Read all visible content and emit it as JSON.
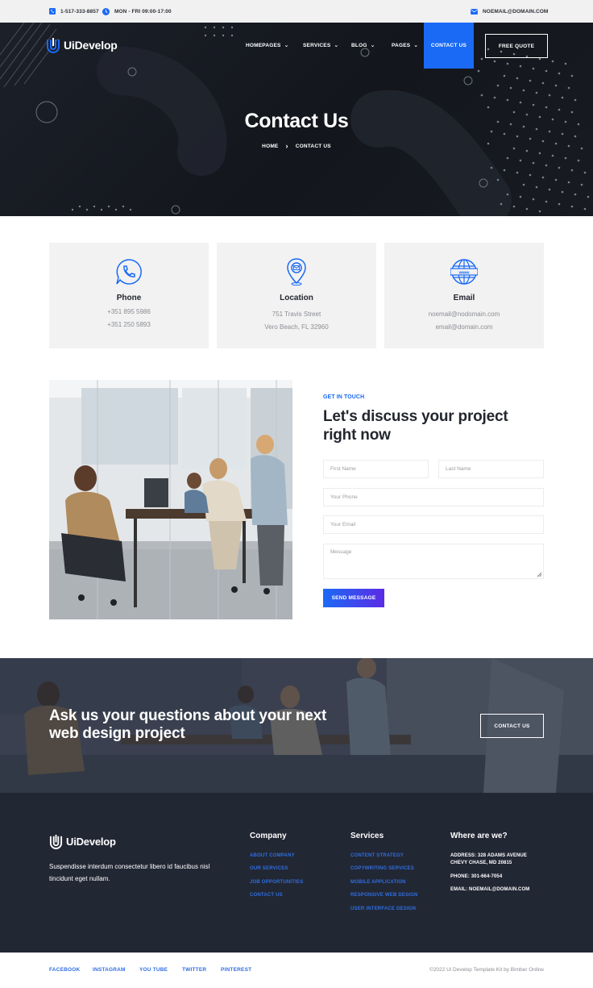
{
  "topbar": {
    "phone": "1-517-333-8857",
    "hours": "MON - FRI 09:00-17:00",
    "email": "NOEMAIL@DOMAIN.COM"
  },
  "brand": {
    "name": "UiDevelop"
  },
  "nav": {
    "items": [
      {
        "label": "HOMEPAGES"
      },
      {
        "label": "SERVICES"
      },
      {
        "label": "BLOG"
      },
      {
        "label": "PAGES"
      }
    ],
    "contact_label": "CONTACT US",
    "quote_label": "FREE QUOTE"
  },
  "hero": {
    "title": "Contact Us",
    "breadcrumb": {
      "home": "HOME",
      "current": "CONTACT US"
    }
  },
  "info_cards": [
    {
      "icon": "phone-icon",
      "title": "Phone",
      "line1": "+351 895 5986",
      "line2": "+351 250 5893"
    },
    {
      "icon": "location-pin-icon",
      "title": "Location",
      "line1": "751 Travis Street",
      "line2": "Vero Beach, FL 32960"
    },
    {
      "icon": "globe-icon",
      "title": "Email",
      "line1": "noemail@nodomain.com",
      "line2": "email@domain.com"
    }
  ],
  "form": {
    "eyebrow": "GET IN TOUCH",
    "title": "Let's discuss your project right now",
    "first_name_placeholder": "First Name",
    "last_name_placeholder": "Last Name",
    "phone_placeholder": "Your Phone",
    "email_placeholder": "Your Email",
    "message_placeholder": "Message",
    "submit_label": "SEND MESSAGE"
  },
  "cta": {
    "title": "Ask us your questions about your next web design project",
    "button_label": "CONTACT US"
  },
  "footer": {
    "brand": "UiDevelop",
    "description": "Suspendisse interdum consectetur libero id faucibus nisl tincidunt eget nullam.",
    "company": {
      "title": "Company",
      "links": [
        "ABOUT COMPANY",
        "OUR SERVICES",
        "JOB OPPORTUNITIES",
        "CONTACT US"
      ]
    },
    "services": {
      "title": "Services",
      "links": [
        "CONTENT STRATEGY",
        "COPYWRITING SERVICES",
        "MOBILE APPLICATION",
        "RESPONSIVE WEB DESIGN",
        "USER INTERFACE DESIGN"
      ]
    },
    "where": {
      "title": "Where are we?",
      "address_line1": "ADDRESS: 328 ADAMS AVENUE",
      "address_line2": "CHEVY CHASE, MD 20815",
      "phone": "PHONE: 301-664-7054",
      "email": "EMAIL: NOEMAIL@DOMAIN.COM"
    }
  },
  "bottom_bar": {
    "social": [
      "FACEBOOK",
      "INSTAGRAM",
      "YOU TUBE",
      "TWITTER",
      "PINTEREST"
    ],
    "copyright": "©2022 Ui Develop Template Kit by Bimber Online"
  },
  "colors": {
    "accent": "#1b6af5",
    "dark": "#222734",
    "hero_bg": "#171a21",
    "card_bg": "#f2f2f2"
  }
}
